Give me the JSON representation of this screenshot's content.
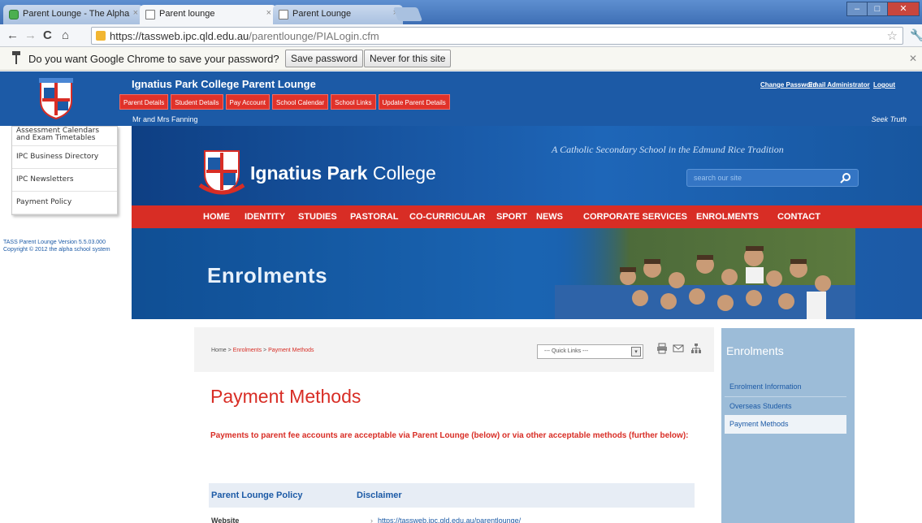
{
  "browser": {
    "tabs": [
      {
        "title": "Parent Lounge - The Alpha",
        "state": "inactive"
      },
      {
        "title": "Parent lounge",
        "state": "active"
      },
      {
        "title": "Parent Lounge",
        "state": "inactive"
      }
    ],
    "url_host": "https://tassweb.ipc.qld.edu.au",
    "url_path": "/parentlounge/PIALogin.cfm",
    "password_bar": {
      "prompt": "Do you want Google Chrome to save your password?",
      "save_label": "Save password",
      "never_label": "Never for this site"
    }
  },
  "parent_lounge": {
    "title": "Ignatius Park College Parent Lounge",
    "tabs": [
      "Parent Details",
      "Student Details",
      "Pay Account",
      "School Calendar",
      "School Links",
      "Update Parent Details"
    ],
    "user": "Mr and Mrs Fanning",
    "links": {
      "change_password": "Change Password",
      "email_admin": "Email Administrator",
      "logout": "Logout"
    },
    "motto": "Seek Truth",
    "left_menu": [
      "Assessment Calendars and Exam Timetables",
      "IPC Business Directory",
      "IPC Newsletters",
      "Payment Policy"
    ],
    "version_info": "TASS Parent Lounge Version 5.5.03.000 Copyright © 2012 the alpha school system"
  },
  "site": {
    "name_bold": "Ignatius Park",
    "name_regular": " College",
    "tagline": "A Catholic Secondary School in the Edmund Rice Tradition",
    "search_placeholder": "search our site",
    "nav": [
      "HOME",
      "IDENTITY",
      "STUDIES",
      "PASTORAL",
      "CO-CURRICULAR",
      "SPORT",
      "NEWS",
      "CORPORATE SERVICES",
      "ENROLMENTS",
      "CONTACT"
    ],
    "hero_title": "Enrolments"
  },
  "content": {
    "breadcrumb": {
      "home": "Home",
      "sep": ">",
      "section": "Enrolments",
      "page": "Payment Methods"
    },
    "quick_links": "--- Quick Links ---",
    "heading": "Payment Methods",
    "intro": "Payments to parent fee accounts are acceptable via Parent Lounge (below) or via other acceptable methods (further below):",
    "table_headers": [
      "Parent Lounge Policy",
      "Disclaimer"
    ],
    "row_website": {
      "label": "Website",
      "link": "https://tassweb.ipc.qld.edu.au/parentlounge/"
    }
  },
  "sidebar": {
    "title": "Enrolments",
    "items": [
      "Enrolment Information",
      "Overseas Students",
      "Payment Methods"
    ],
    "active_index": 2
  },
  "colors": {
    "brand_blue": "#1c5aa6",
    "brand_red": "#d82d25",
    "sidebar_blue": "#9cbcd8"
  }
}
